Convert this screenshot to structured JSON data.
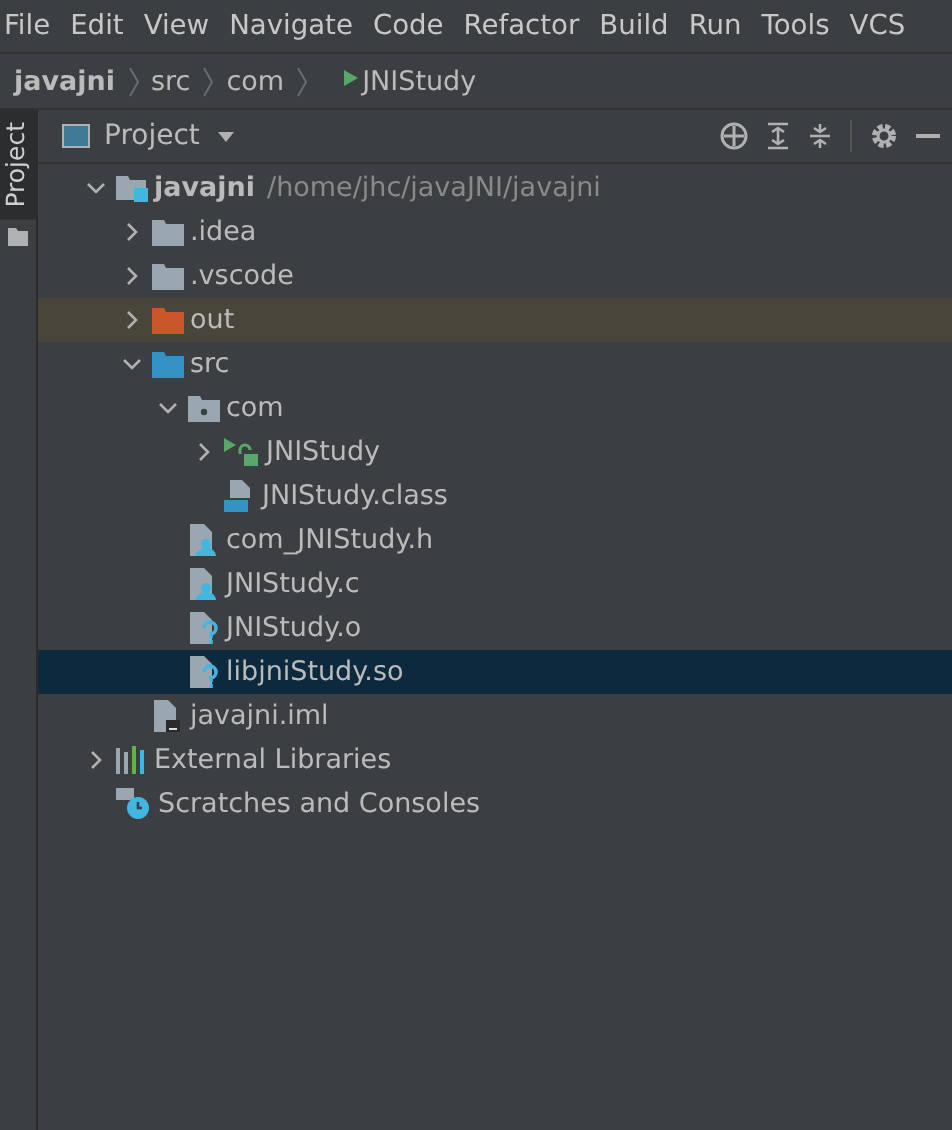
{
  "menu": [
    "File",
    "Edit",
    "View",
    "Navigate",
    "Code",
    "Refactor",
    "Build",
    "Run",
    "Tools",
    "VCS"
  ],
  "breadcrumb": [
    {
      "label": "javajni",
      "kind": "project"
    },
    {
      "label": "src",
      "kind": "folder"
    },
    {
      "label": "com",
      "kind": "folder"
    },
    {
      "label": "JNIStudy",
      "kind": "class"
    }
  ],
  "side_tab": {
    "label": "Project",
    "selected": true
  },
  "panel": {
    "title": "Project"
  },
  "tree": [
    {
      "label": "javajni",
      "path": "/home/jhc/javaJNI/javajni",
      "kind": "module",
      "expanded": true,
      "selected": false,
      "excluded": false,
      "children": [
        {
          "label": ".idea",
          "kind": "folder",
          "expanded": false,
          "selected": false,
          "excluded": false
        },
        {
          "label": ".vscode",
          "kind": "folder",
          "expanded": false,
          "selected": false,
          "excluded": false
        },
        {
          "label": "out",
          "kind": "excluded-folder",
          "expanded": false,
          "selected": false,
          "excluded": true
        },
        {
          "label": "src",
          "kind": "source-folder",
          "expanded": true,
          "selected": false,
          "excluded": false,
          "children": [
            {
              "label": "com",
              "kind": "package",
              "expanded": true,
              "selected": false,
              "excluded": false,
              "children": [
                {
                  "label": "JNIStudy",
                  "kind": "java-class",
                  "expanded": false,
                  "selected": false,
                  "excluded": false
                },
                {
                  "label": "JNIStudy.class",
                  "kind": "class-file",
                  "selected": false,
                  "excluded": false
                }
              ]
            },
            {
              "label": "com_JNIStudy.h",
              "kind": "c-file",
              "selected": false,
              "excluded": false
            },
            {
              "label": "JNIStudy.c",
              "kind": "c-file",
              "selected": false,
              "excluded": false
            },
            {
              "label": "JNIStudy.o",
              "kind": "unknown-file",
              "selected": false,
              "excluded": false
            },
            {
              "label": "libjniStudy.so",
              "kind": "unknown-file",
              "selected": true,
              "excluded": false
            }
          ]
        },
        {
          "label": "javajni.iml",
          "kind": "iml-file",
          "selected": false,
          "excluded": false
        }
      ]
    },
    {
      "label": "External Libraries",
      "kind": "libraries",
      "expanded": false,
      "selected": false,
      "excluded": false
    },
    {
      "label": "Scratches and Consoles",
      "kind": "scratches",
      "selected": false,
      "excluded": false
    }
  ]
}
